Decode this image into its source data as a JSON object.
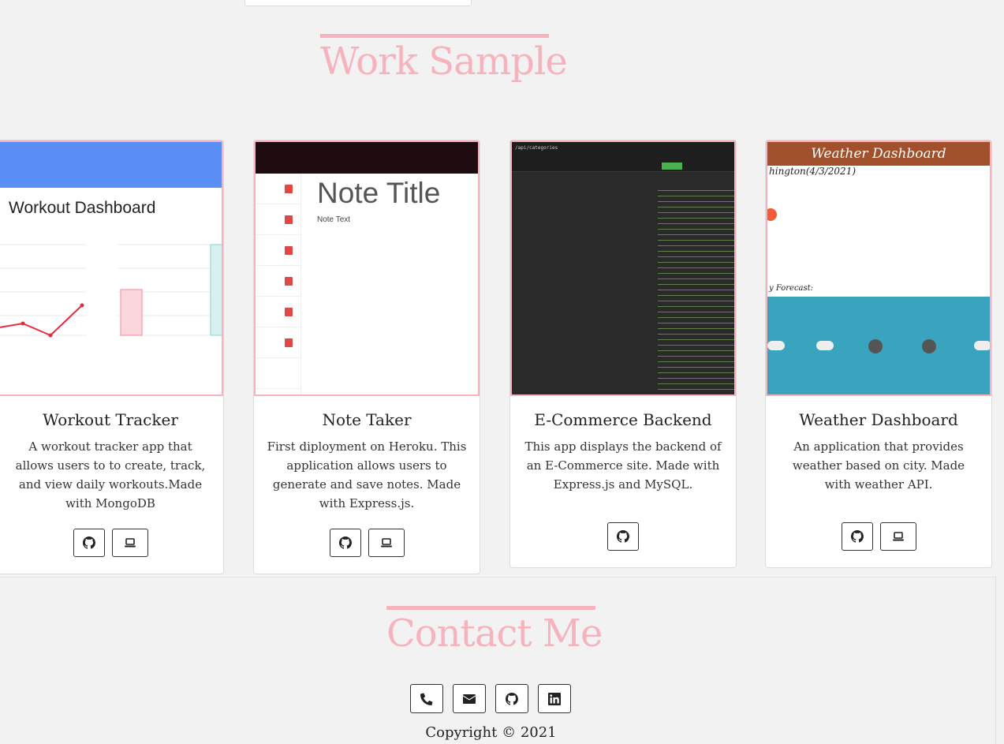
{
  "work_section": {
    "title": "Work Sample"
  },
  "projects": [
    {
      "name": "Workout Tracker",
      "description": "A workout tracker app that allows users to to create, track, and view daily workouts.Made with MongoDB",
      "thumbnail_text": "Workout Dashboard",
      "buttons": [
        "github-icon",
        "laptop-icon"
      ]
    },
    {
      "name": "Note Taker",
      "description": "First diployment on Heroku. This application allows users to generate and save notes. Made with Express.js.",
      "thumbnail_text": "Note Title",
      "thumbnail_subtext": "Note Text",
      "buttons": [
        "github-icon",
        "laptop-icon"
      ]
    },
    {
      "name": "E-Commerce Backend",
      "description": "This app displays the backend of an E-Commerce site. Made with Express.js and MySQL.",
      "thumbnail_text": "/api/categories",
      "buttons": [
        "github-icon"
      ]
    },
    {
      "name": "Weather Dashboard",
      "description": "An application that provides weather based on city. Made with weather API.",
      "thumbnail_text": "Weather Dashboard",
      "thumbnail_city": "hington(4/3/2021)",
      "thumbnail_forecast": "y Forecast:",
      "buttons": [
        "github-icon",
        "laptop-icon"
      ]
    }
  ],
  "contact_section": {
    "title": "Contact Me",
    "buttons": [
      "phone-icon",
      "envelope-icon",
      "github-icon",
      "linkedin-icon"
    ]
  },
  "footer": {
    "copyright": "Copyright © 2021"
  },
  "colors": {
    "accent": "#f6b3bd",
    "background": "#f2f2f2"
  }
}
